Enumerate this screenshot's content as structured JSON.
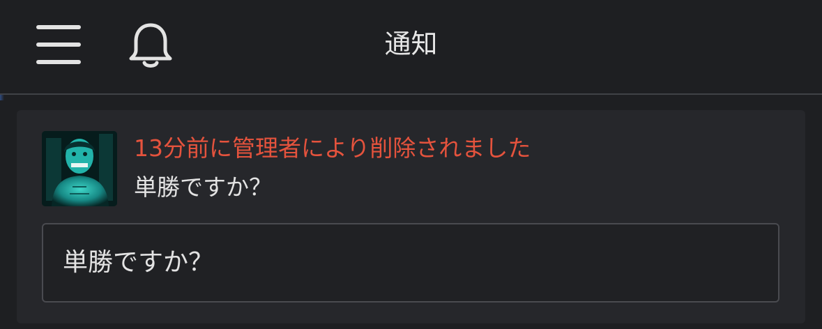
{
  "header": {
    "title": "通知",
    "menu_icon": "hamburger-menu-icon",
    "bell_icon": "bell-icon"
  },
  "notification": {
    "avatar": "user-avatar",
    "status_text": "13分前に管理者により削除されました",
    "message_text": "単勝ですか？",
    "quoted_message": "単勝ですか？"
  },
  "colors": {
    "background": "#1e1f22",
    "card": "#26272b",
    "status_red": "#e5533d",
    "text": "#e3e3e3"
  }
}
